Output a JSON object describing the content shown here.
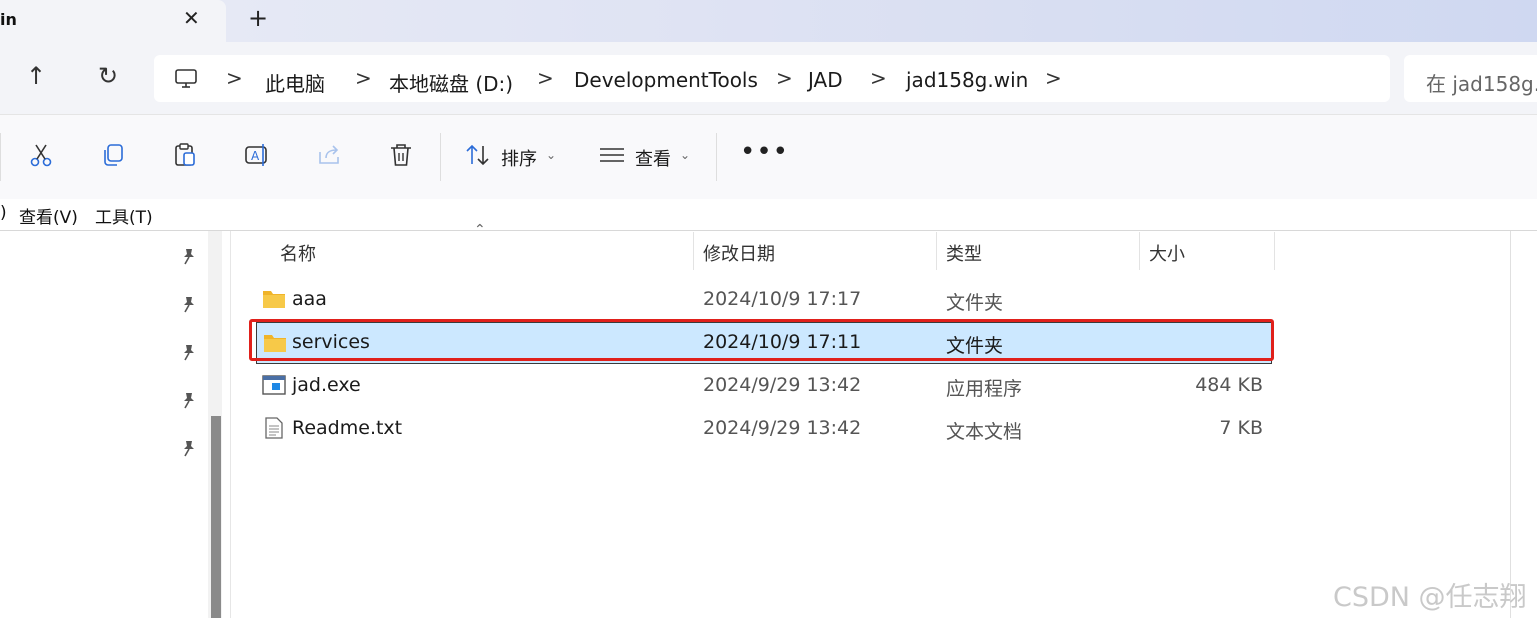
{
  "tab": {
    "title": "in",
    "close": "✕",
    "new": "+"
  },
  "nav": {
    "up": "↑",
    "refresh": "↻"
  },
  "breadcrumb": {
    "items": [
      "此电脑",
      "本地磁盘 (D:)",
      "DevelopmentTools",
      "JAD",
      "jad158g.win"
    ],
    "separator": ">"
  },
  "search": {
    "placeholder": "在 jad158g.w"
  },
  "toolbar": {
    "sort_label": "排序",
    "view_label": "查看",
    "caret": "⌄",
    "more": "•••"
  },
  "menubar": {
    "partial": ")",
    "view": "查看(V)",
    "tools": "工具(T)"
  },
  "columns": {
    "name": "名称",
    "modified": "修改日期",
    "type": "类型",
    "size": "大小",
    "sort_arrow": "⌃"
  },
  "files": [
    {
      "name": "aaa",
      "modified": "2024/10/9 17:17",
      "type": "文件夹",
      "size": "",
      "icon": "folder-icon"
    },
    {
      "name": "services",
      "modified": "2024/10/9 17:11",
      "type": "文件夹",
      "size": "",
      "icon": "folder-icon"
    },
    {
      "name": "jad.exe",
      "modified": "2024/9/29 13:42",
      "type": "应用程序",
      "size": "484 KB",
      "icon": "exe-icon"
    },
    {
      "name": "Readme.txt",
      "modified": "2024/9/29 13:42",
      "type": "文本文档",
      "size": "7 KB",
      "icon": "text-file-icon"
    }
  ],
  "watermark": "CSDN @任志翔",
  "colors": {
    "selection": "#cce8ff",
    "highlight": "#e0201b",
    "folder": "#f7c948"
  }
}
